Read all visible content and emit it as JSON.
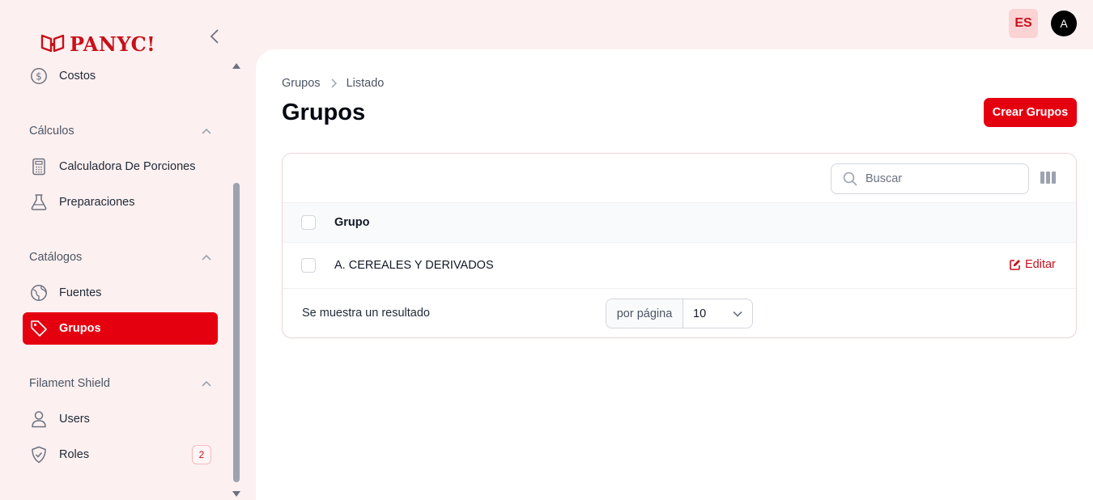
{
  "brand": {
    "name": "PANYC!",
    "color": "#c8101a"
  },
  "sidebar": {
    "items_top": [
      {
        "label": "Costos",
        "icon": "dollar-circle-icon"
      }
    ],
    "groups": [
      {
        "label": "Cálculos",
        "items": [
          {
            "label": "Calculadora De Porciones",
            "icon": "calculator-icon"
          },
          {
            "label": "Preparaciones",
            "icon": "beaker-icon"
          }
        ]
      },
      {
        "label": "Catálogos",
        "items": [
          {
            "label": "Fuentes",
            "icon": "globe-icon"
          },
          {
            "label": "Grupos",
            "icon": "tag-icon",
            "active": true
          }
        ]
      },
      {
        "label": "Filament Shield",
        "items": [
          {
            "label": "Users",
            "icon": "user-icon"
          },
          {
            "label": "Roles",
            "icon": "shield-check-icon",
            "badge": "2"
          }
        ]
      }
    ]
  },
  "topbar": {
    "language": "ES",
    "avatar_initial": "A"
  },
  "breadcrumb": [
    "Grupos",
    "Listado"
  ],
  "page": {
    "title": "Grupos",
    "create_label": "Crear Grupos"
  },
  "table": {
    "search_placeholder": "Buscar",
    "columns": [
      "Grupo"
    ],
    "rows": [
      {
        "grupo": "A. CEREALES Y DERIVADOS",
        "action": "Editar"
      }
    ],
    "footer_text": "Se muestra un resultado",
    "per_page_label": "por página",
    "per_page_value": "10"
  },
  "colors": {
    "accent": "#e50010",
    "background": "#fdf0f0"
  }
}
